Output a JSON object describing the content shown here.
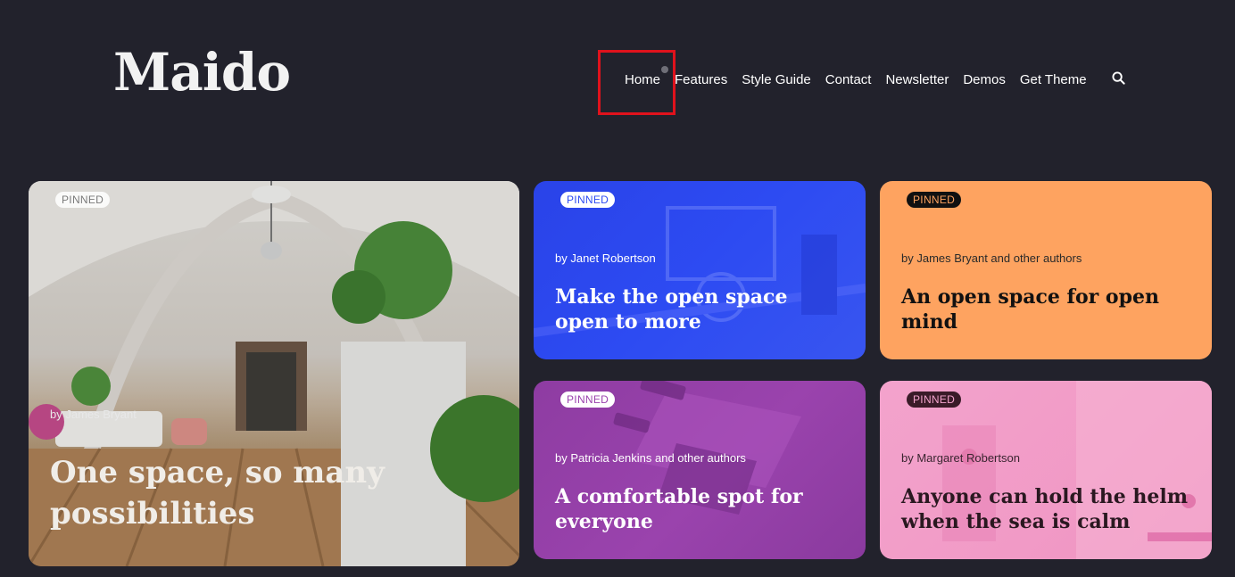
{
  "header": {
    "logo": "Maido",
    "nav": [
      "Home",
      "Features",
      "Style Guide",
      "Contact",
      "Newsletter",
      "Demos",
      "Get Theme"
    ],
    "search_icon": "search-icon"
  },
  "cards": [
    {
      "badge": "PINNED",
      "author": "by James Bryant",
      "title": "One space, so many possibilities",
      "color": "#cfcac3"
    },
    {
      "badge": "PINNED",
      "author": "by Janet Robertson",
      "title": "Make the open space open to more",
      "color": "#2d4bf2"
    },
    {
      "badge": "PINNED",
      "author": "by James Bryant and other authors",
      "title": "An open space for open mind",
      "color": "#fea360"
    },
    {
      "badge": "PINNED",
      "author": "by Patricia Jenkins and other authors",
      "title": "A comfortable spot for everyone",
      "color": "#9a43ad"
    },
    {
      "badge": "PINNED",
      "author": "by Margaret Robertson",
      "title": "Anyone can hold the helm when the sea is calm",
      "color": "#f3a3cc"
    }
  ]
}
